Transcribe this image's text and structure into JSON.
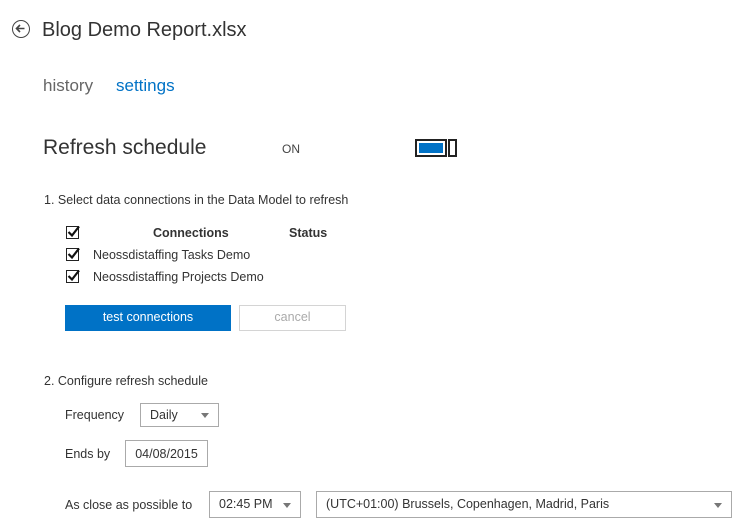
{
  "header": {
    "title": "Blog Demo Report.xlsx"
  },
  "tabs": [
    {
      "label": "history",
      "active": false
    },
    {
      "label": "settings",
      "active": true
    }
  ],
  "refresh": {
    "title": "Refresh schedule",
    "state_label": "ON",
    "enabled": true
  },
  "step1": {
    "text": "1.  Select data connections in the Data Model to refresh",
    "headers": {
      "connections": "Connections",
      "status": "Status"
    },
    "select_all_checked": true,
    "connections": [
      {
        "name": "Neossdistaffing Tasks Demo",
        "checked": true
      },
      {
        "name": "Neossdistaffing Projects Demo",
        "checked": true
      }
    ],
    "test_button": "test connections",
    "cancel_button": "cancel"
  },
  "step2": {
    "text": "2.  Configure refresh schedule",
    "frequency": {
      "label": "Frequency",
      "value": "Daily"
    },
    "ends_by": {
      "label": "Ends by",
      "value": "04/08/2015"
    },
    "close_to": {
      "label": "As close as possible to",
      "time": "02:45 PM",
      "timezone": "(UTC+01:00) Brussels, Copenhagen, Madrid, Paris"
    }
  },
  "colors": {
    "accent": "#0072c6",
    "text": "#333333"
  },
  "icons": {
    "back": "back-arrow-circle-icon",
    "check": "checkmark-icon",
    "dropdown": "triangle-down-icon"
  }
}
